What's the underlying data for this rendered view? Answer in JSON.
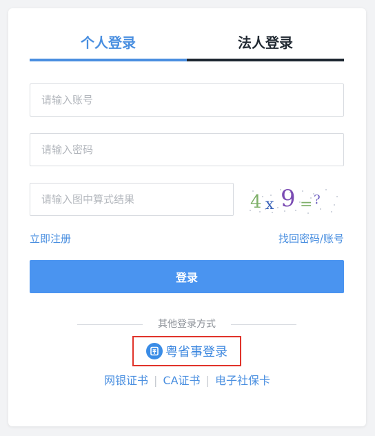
{
  "tabs": {
    "personal": "个人登录",
    "legal": "法人登录"
  },
  "form": {
    "account_placeholder": "请输入账号",
    "password_placeholder": "请输入密码",
    "captcha_placeholder": "请输入图中算式结果",
    "captcha_image_text": "4x9=?"
  },
  "links": {
    "register": "立即注册",
    "recover": "找回密码/账号"
  },
  "login_button": "登录",
  "other_methods": {
    "divider_text": "其他登录方式",
    "yss_label": "粤省事登录",
    "yss_icon": "yueshengshi-icon",
    "alt": [
      "网银证书",
      "CA证书",
      "电子社保卡"
    ]
  },
  "colors": {
    "accent": "#4a8fe0",
    "button": "#4a94f0",
    "highlight_border": "#e0332a",
    "dark_tab": "#1d2630"
  }
}
